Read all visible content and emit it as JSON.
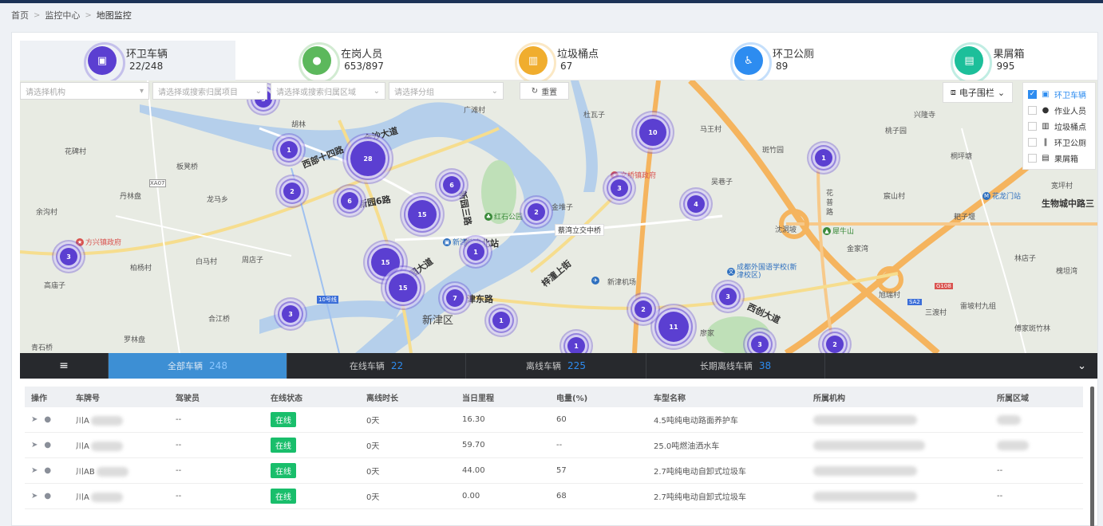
{
  "breadcrumb": {
    "home": "首页",
    "monitor": "监控中心",
    "current": "地图监控"
  },
  "stats": [
    {
      "label": "环卫车辆",
      "value": "22/248",
      "icon": "vehicle-icon",
      "color": "#5b3fd1"
    },
    {
      "label": "在岗人员",
      "value": "653/897",
      "icon": "person-icon",
      "color": "#5cb85c"
    },
    {
      "label": "垃圾桶点",
      "value": "67",
      "icon": "trash-bin-icon",
      "color": "#f0ad2e"
    },
    {
      "label": "环卫公厕",
      "value": "89",
      "icon": "toilet-icon",
      "color": "#2d8cf0"
    },
    {
      "label": "果屑箱",
      "value": "995",
      "icon": "box-icon",
      "color": "#1cbf9a"
    }
  ],
  "filters": {
    "org": "请选择机构",
    "project": "请选择或搜索归属项目",
    "area": "请选择或搜索归属区域",
    "group": "请选择分组",
    "reset": "重置"
  },
  "fence_button": "电子围栏",
  "layers": [
    {
      "label": "环卫车辆",
      "checked": true,
      "icon": "vehicle-icon"
    },
    {
      "label": "作业人员",
      "checked": false,
      "icon": "person-icon"
    },
    {
      "label": "垃圾桶点",
      "checked": false,
      "icon": "trash-bin-icon"
    },
    {
      "label": "环卫公厕",
      "checked": false,
      "icon": "toilet-icon"
    },
    {
      "label": "果屑箱",
      "checked": false,
      "icon": "box-icon"
    }
  ],
  "map": {
    "labels": [
      "胡林",
      "花碑村",
      "板凳桥",
      "丹林盘",
      "龙马乡",
      "余沟村",
      "柏杨村",
      "白马村",
      "周店子",
      "高庙子",
      "合江桥",
      "罗林盘",
      "青石桥",
      "广滩村",
      "杜瓦子",
      "马王村",
      "吴巷子",
      "斑竹园",
      "新津区",
      "兴隆寺",
      "桃子园",
      "桐坪塘",
      "宸山村",
      "沈洞坡",
      "花",
      "普",
      "路",
      "金家湾",
      "林店子",
      "槐坦湾",
      "雷坡村九组",
      "傅家斑竹林",
      "廖家",
      "三渡村",
      "耙子堰",
      "旭瑞村",
      "宽坪村",
      "金堆子",
      "新津机场",
      "生物城中路三",
      "XA07",
      "10号线",
      "G108",
      "SA2"
    ],
    "roads": [
      "西部十四路",
      "金沙大道",
      "新园6路",
      "新园三路",
      "兴园大道",
      "津东路",
      "梓潼上街",
      "西创大道",
      "新津北站"
    ],
    "pois": [
      "方兴镇政府",
      "文桥镇政府",
      "红石公园",
      "成都外国语学校(新津校区)",
      "犀牛山",
      "花龙门站",
      "蔡湾立交中桥",
      "新津站"
    ],
    "clusters": [
      "28",
      "15",
      "15",
      "15",
      "11",
      "10",
      "7",
      "6",
      "6",
      "4",
      "3",
      "3",
      "3",
      "3",
      "3",
      "3",
      "2",
      "2",
      "2",
      "2",
      "1",
      "1",
      "1",
      "1",
      "1"
    ]
  },
  "tabs": [
    {
      "label": "全部车辆",
      "count": "248"
    },
    {
      "label": "在线车辆",
      "count": "22"
    },
    {
      "label": "离线车辆",
      "count": "225"
    },
    {
      "label": "长期离线车辆",
      "count": "38"
    }
  ],
  "table": {
    "headers": [
      "操作",
      "车牌号",
      "驾驶员",
      "在线状态",
      "离线时长",
      "当日里程",
      "电量(%)",
      "车型名称",
      "所属机构",
      "所属区域"
    ],
    "rows": [
      {
        "plate": "川A",
        "driver": "--",
        "status": "在线",
        "offline": "0天",
        "mileage": "16.30",
        "battery": "60",
        "model": "4.5吨纯电动路面养护车",
        "area": ""
      },
      {
        "plate": "川A",
        "driver": "--",
        "status": "在线",
        "offline": "0天",
        "mileage": "59.70",
        "battery": "--",
        "model": "25.0吨燃油洒水车",
        "area": ""
      },
      {
        "plate": "川AB",
        "driver": "--",
        "status": "在线",
        "offline": "0天",
        "mileage": "44.00",
        "battery": "57",
        "model": "2.7吨纯电动自卸式垃圾车",
        "area": "--"
      },
      {
        "plate": "川A",
        "driver": "--",
        "status": "在线",
        "offline": "0天",
        "mileage": "0.00",
        "battery": "68",
        "model": "2.7吨纯电动自卸式垃圾车",
        "area": "--"
      }
    ]
  }
}
